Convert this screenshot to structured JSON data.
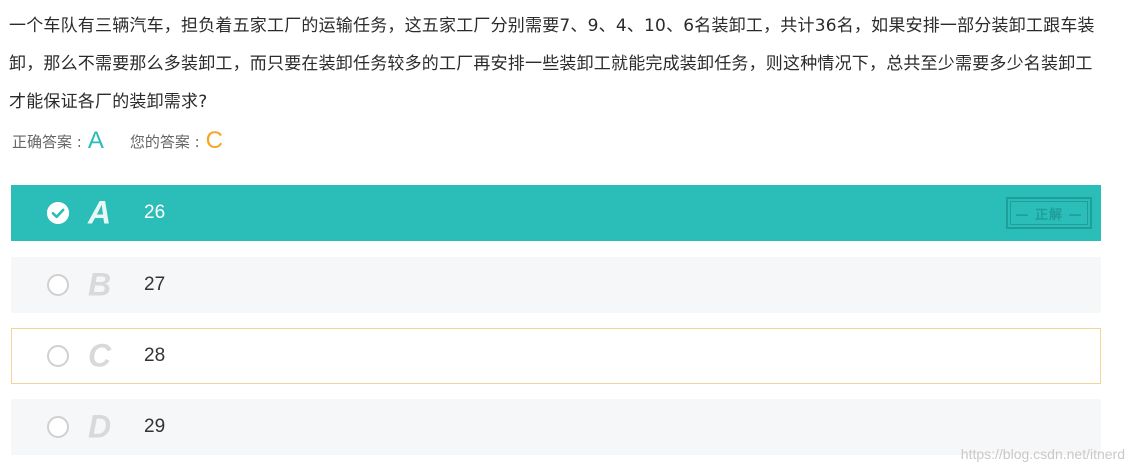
{
  "question": {
    "text": "一个车队有三辆汽车，担负着五家工厂的运输任务，这五家工厂分别需要7、9、4、10、6名装卸工，共计36名，如果安排一部分装卸工跟车装卸，那么不需要那么多装卸工，而只要在装卸任务较多的工厂再安排一些装卸工就能完成装卸任务，则这种情况下，总共至少需要多少名装卸工才能保证各厂的装卸需求?"
  },
  "answer_summary": {
    "correct_label": "正确答案 :",
    "correct_value": "A",
    "mine_label": "您的答案 :",
    "mine_value": "C"
  },
  "options": [
    {
      "letter": "A",
      "text": "26",
      "state": "correct"
    },
    {
      "letter": "B",
      "text": "27",
      "state": "normal"
    },
    {
      "letter": "C",
      "text": "28",
      "state": "user-selected"
    },
    {
      "letter": "D",
      "text": "29",
      "state": "normal"
    }
  ],
  "stamp": {
    "text": "— 正解 —"
  },
  "watermark": {
    "text": "https://blog.csdn.net/itnerd"
  },
  "colors": {
    "correct": "#2bbdb8",
    "user_answer": "#f5a623",
    "user_border": "#f3d59a",
    "option_bg": "#f6f7f9",
    "stamp": "#1f9f9a"
  },
  "icons": {
    "option_a": "check-circle-icon",
    "option_other": "radio-circle-icon"
  }
}
